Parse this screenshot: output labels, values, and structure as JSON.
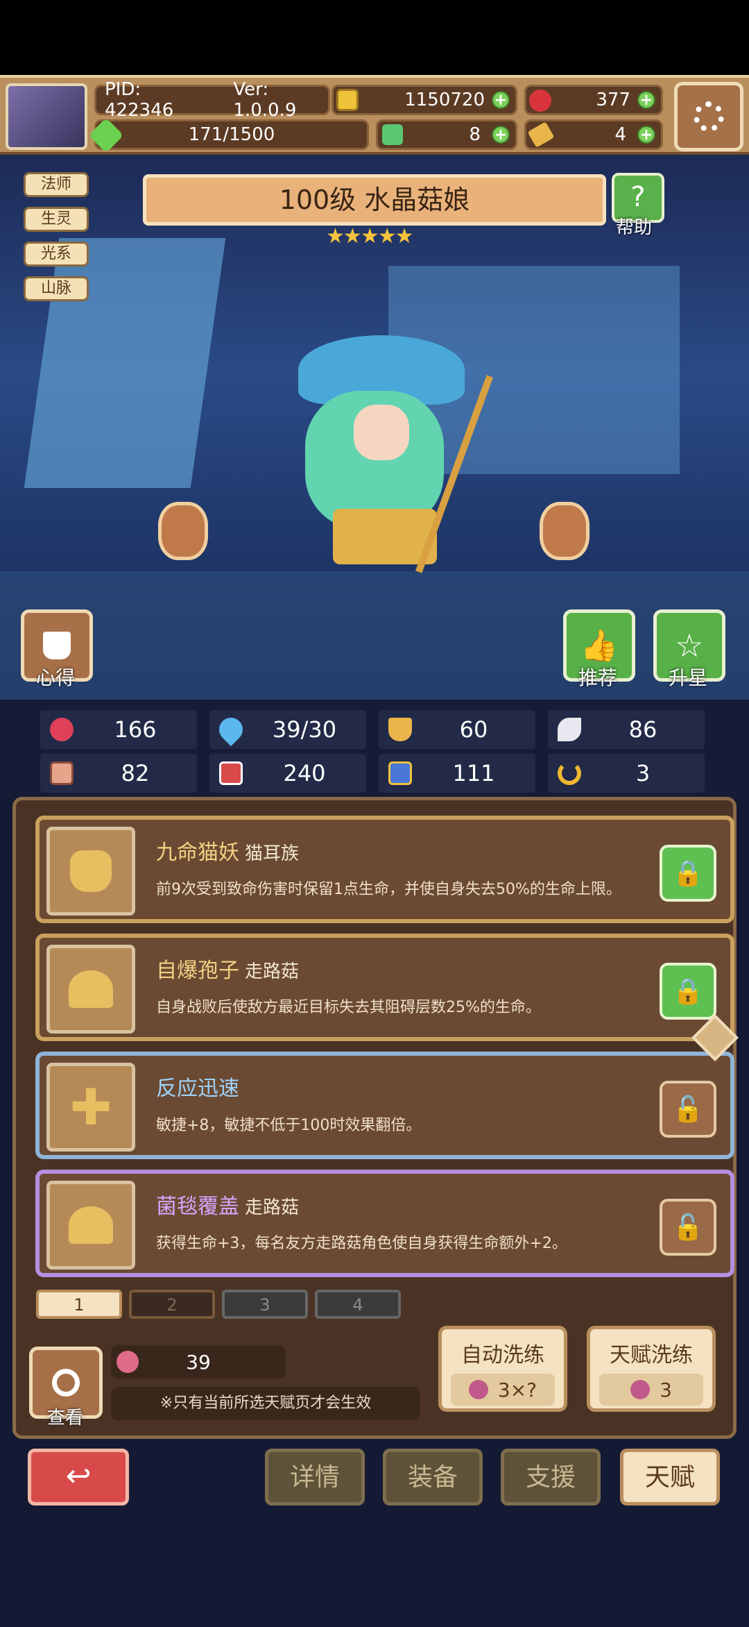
{
  "header": {
    "pid": "PID: 422346",
    "version": "Ver: 1.0.0.9",
    "gold": "1150720",
    "energy": "171/1500",
    "gems": "377",
    "clover": "8",
    "key": "4"
  },
  "character": {
    "title": "100级 水晶菇娘",
    "stars": 5,
    "help_label": "帮助",
    "tags": [
      "法师",
      "生灵",
      "光系",
      "山脉"
    ],
    "left_button": "心得",
    "right_buttons": [
      "推荐",
      "升星"
    ]
  },
  "stats": [
    {
      "icon": "heart-icon",
      "value": "166",
      "color": "#e0405a"
    },
    {
      "icon": "droplet-icon",
      "value": "39/30",
      "color": "#5ab8ee"
    },
    {
      "icon": "shield-icon",
      "value": "60",
      "color": "#e9b54a"
    },
    {
      "icon": "wing-icon",
      "value": "86",
      "color": "#e8e8f0"
    },
    {
      "icon": "fist-icon",
      "value": "82",
      "color": "#e6a48a"
    },
    {
      "icon": "book-icon",
      "value": "240",
      "color": "#d84a4a"
    },
    {
      "icon": "stairs-icon",
      "value": "111",
      "color": "#4a78d8"
    },
    {
      "icon": "horseshoe-icon",
      "value": "3",
      "color": "#f0b830"
    }
  ],
  "talents": [
    {
      "name": "九命猫妖",
      "type": "猫耳族",
      "desc": "前9次受到致命伤害时保留1点生命，并使自身失去50%的生命上限。",
      "name_color": "#f3d184",
      "border": "#c9a05d",
      "locked": true
    },
    {
      "name": "自爆孢子",
      "type": "走路菇",
      "desc": "自身战败后使敌方最近目标失去其阻碍层数25%的生命。",
      "name_color": "#f3d184",
      "border": "#c9a05d",
      "locked": true
    },
    {
      "name": "反应迅速",
      "type": "",
      "desc": "敏捷+8，敏捷不低于100时效果翻倍。",
      "name_color": "#9ed3ff",
      "border": "#8fb4d8",
      "locked": false
    },
    {
      "name": "菌毯覆盖",
      "type": "走路菇",
      "desc": "获得生命+3，每名友方走路菇角色使自身获得生命额外+2。",
      "name_color": "#d7a6ff",
      "border": "#b58ee0",
      "locked": false
    }
  ],
  "pages": [
    "1",
    "2",
    "3",
    "4"
  ],
  "active_page": 0,
  "reroll": {
    "count": "39",
    "note": "※只有当前所选天赋页才会生效",
    "view_label": "查看",
    "auto_label": "自动洗练",
    "auto_cost": "3×?",
    "talent_label": "天赋洗练",
    "talent_cost": "3"
  },
  "bottom_nav": [
    "详情",
    "装备",
    "支援",
    "天赋"
  ]
}
